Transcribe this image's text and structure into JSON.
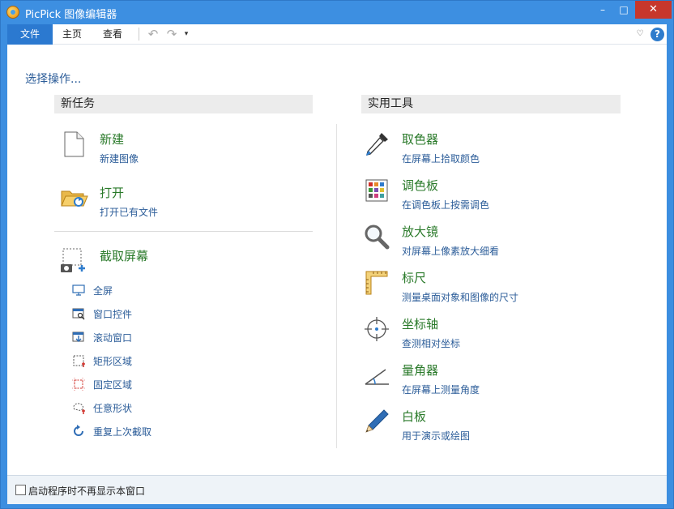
{
  "window": {
    "title": "PicPick 图像编辑器",
    "min_glyph": "–",
    "max_glyph": "□",
    "close_glyph": "✕"
  },
  "menu": {
    "file": "文件",
    "home": "主页",
    "view": "查看",
    "undo_glyph": "↶",
    "redo_glyph": "↷",
    "dropdown_glyph": "▾",
    "collapse_glyph": "♡",
    "help_glyph": "?"
  },
  "content": {
    "prompt": "选择操作..."
  },
  "new_tasks": {
    "header": "新任务",
    "items": [
      {
        "title": "新建",
        "subtitle": "新建图像",
        "icon": "new-file-icon"
      },
      {
        "title": "打开",
        "subtitle": "打开已有文件",
        "icon": "open-folder-icon"
      }
    ],
    "capture": {
      "title": "截取屏幕",
      "icon": "screen-capture-icon",
      "options": [
        {
          "label": "全屏",
          "icon": "monitor-icon"
        },
        {
          "label": "窗口控件",
          "icon": "window-control-icon"
        },
        {
          "label": "滚动窗口",
          "icon": "scroll-window-icon"
        },
        {
          "label": "矩形区域",
          "icon": "rect-region-icon"
        },
        {
          "label": "固定区域",
          "icon": "fixed-region-icon"
        },
        {
          "label": "任意形状",
          "icon": "freehand-icon"
        },
        {
          "label": "重复上次截取",
          "icon": "repeat-icon"
        }
      ]
    }
  },
  "tools": {
    "header": "实用工具",
    "items": [
      {
        "title": "取色器",
        "subtitle": "在屏幕上拾取颜色",
        "icon": "eyedropper-icon"
      },
      {
        "title": "调色板",
        "subtitle": "在调色板上按需调色",
        "icon": "palette-icon"
      },
      {
        "title": "放大镜",
        "subtitle": "对屏幕上像素放大细看",
        "icon": "magnifier-icon"
      },
      {
        "title": "标尺",
        "subtitle": "测量桌面对象和图像的尺寸",
        "icon": "ruler-icon"
      },
      {
        "title": "坐标轴",
        "subtitle": "查测相对坐标",
        "icon": "crosshair-icon"
      },
      {
        "title": "量角器",
        "subtitle": "在屏幕上测量角度",
        "icon": "protractor-icon"
      },
      {
        "title": "白板",
        "subtitle": "用于演示或绘图",
        "icon": "whiteboard-pen-icon"
      }
    ]
  },
  "footer": {
    "checkbox_label": "启动程序时不再显示本窗口",
    "checked": false
  }
}
